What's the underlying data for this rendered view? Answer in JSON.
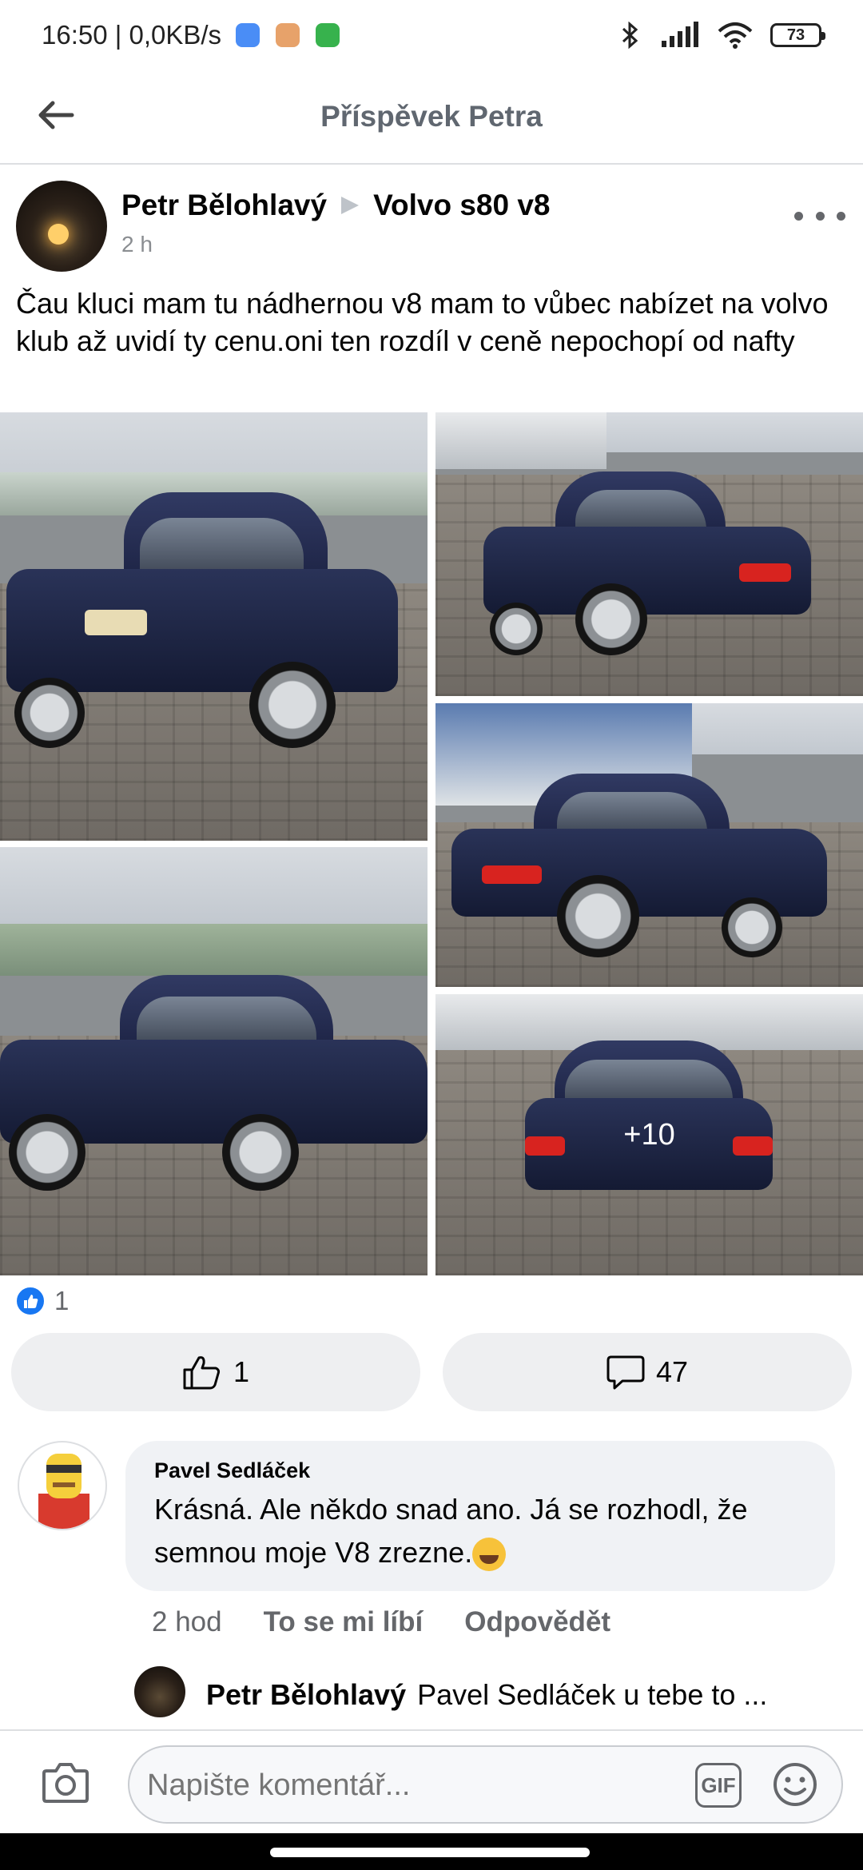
{
  "status_bar": {
    "time_speed": "16:50 | 0,0KB/s",
    "battery": "73"
  },
  "header": {
    "title": "Příspěvek Petra"
  },
  "post": {
    "author": "Petr Bělohlavý",
    "target": "Volvo s80 v8",
    "time": "2 h",
    "text": "Čau kluci mam tu nádhernou v8 mam to vůbec nabízet na volvo klub až uvidí ty cenu.oni ten rozdíl v ceně nepochopí od nafty",
    "more_photos_label": "+10"
  },
  "reactions": {
    "count": "1",
    "like_count": "1",
    "comment_count": "47"
  },
  "comment": {
    "author": "Pavel Sedláček",
    "text": "Krásná. Ale někdo snad ano. Já se rozhodl, že semnou moje V8 zrezne.",
    "time": "2 hod",
    "like_label": "To se mi líbí",
    "reply_label": "Odpovědět"
  },
  "reply_preview": {
    "author": "Petr Bělohlavý",
    "text": "Pavel Sedláček u tebe to ..."
  },
  "composer": {
    "placeholder": "Napište komentář...",
    "gif_label": "GIF"
  },
  "icons": {
    "back": "arrow-left-icon",
    "more": "more-dots-icon",
    "like": "thumb-up-icon",
    "comment": "speech-bubble-icon",
    "camera": "camera-icon",
    "emoji": "smiley-icon"
  },
  "colors": {
    "accent": "#1877f2",
    "bubble": "#f0f2f5",
    "pill": "#eeeff1",
    "muted": "#65676b"
  }
}
